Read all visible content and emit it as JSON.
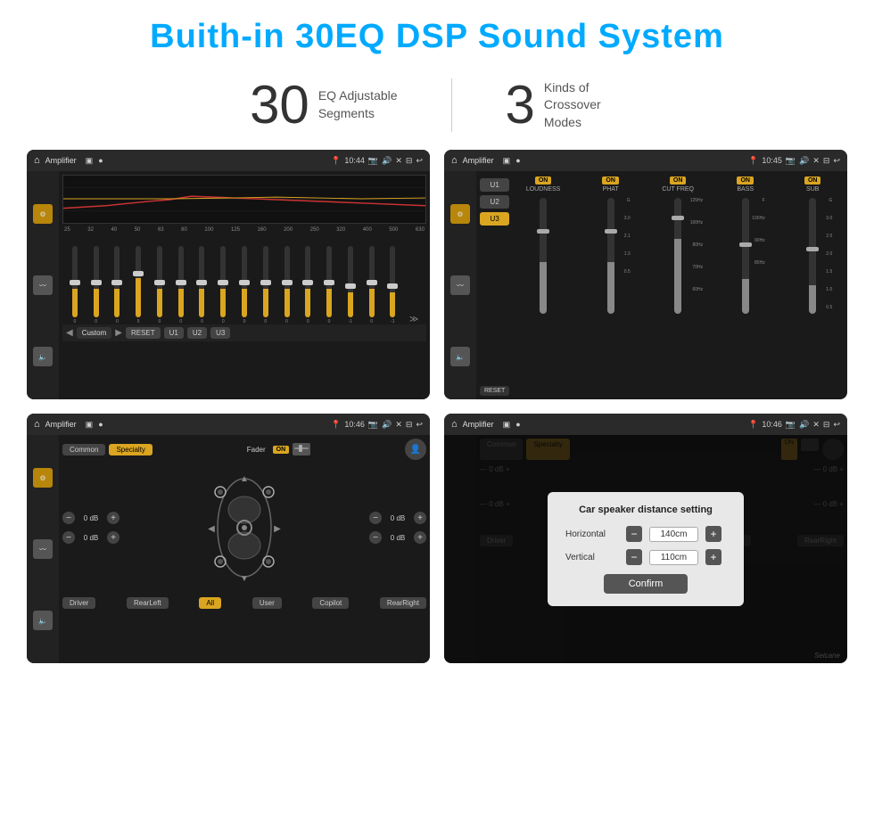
{
  "header": {
    "title": "Buith-in 30EQ DSP Sound System"
  },
  "stats": [
    {
      "number": "30",
      "text": "EQ Adjustable\nSegments"
    },
    {
      "number": "3",
      "text": "Kinds of\nCrossover Modes"
    }
  ],
  "screens": {
    "eq": {
      "topbar": {
        "title": "Amplifier",
        "time": "10:44"
      },
      "freq_labels": [
        "25",
        "32",
        "40",
        "50",
        "63",
        "80",
        "100",
        "125",
        "160",
        "200",
        "250",
        "320",
        "400",
        "500",
        "630"
      ],
      "sliders": [
        0,
        0,
        0,
        5,
        0,
        0,
        0,
        0,
        0,
        0,
        0,
        0,
        0,
        -1,
        0,
        -1
      ],
      "preset_label": "Custom",
      "buttons": [
        "RESET",
        "U1",
        "U2",
        "U3"
      ]
    },
    "crossover": {
      "topbar": {
        "title": "Amplifier",
        "time": "10:45"
      },
      "presets": [
        "U1",
        "U2",
        "U3"
      ],
      "active_preset": "U3",
      "bands": [
        {
          "label": "LOUDNESS",
          "on": true
        },
        {
          "label": "PHAT",
          "on": true
        },
        {
          "label": "CUT FREQ",
          "on": true
        },
        {
          "label": "BASS",
          "on": true
        },
        {
          "label": "SUB",
          "on": true
        }
      ]
    },
    "speaker": {
      "topbar": {
        "title": "Amplifier",
        "time": "10:46"
      },
      "tabs": [
        "Common",
        "Specialty"
      ],
      "active_tab": "Specialty",
      "fader_label": "Fader",
      "fader_on": "ON",
      "volumes": {
        "top_left": "0 dB",
        "top_right": "0 dB",
        "bottom_left": "0 dB",
        "bottom_right": "0 dB"
      },
      "bottom_buttons": [
        "Driver",
        "RearLeft",
        "All",
        "User",
        "Copilot",
        "RearRight"
      ],
      "all_active": true
    },
    "dialog": {
      "topbar": {
        "title": "Amplifier",
        "time": "10:46"
      },
      "dialog_title": "Car speaker distance setting",
      "horizontal_label": "Horizontal",
      "horizontal_value": "140cm",
      "vertical_label": "Vertical",
      "vertical_value": "110cm",
      "confirm_label": "Confirm"
    }
  },
  "watermark": "Seicane"
}
